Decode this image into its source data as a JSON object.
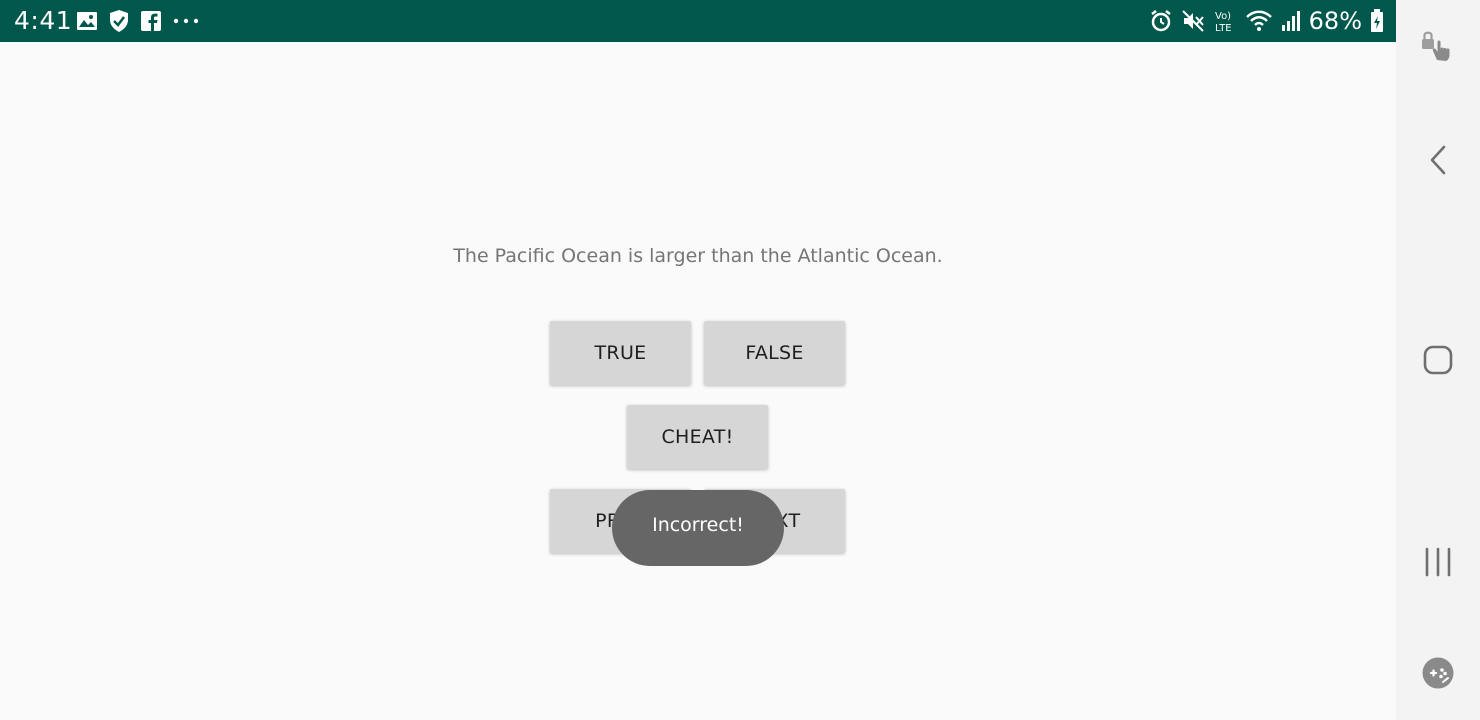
{
  "status_bar": {
    "time": "4:41",
    "left_icons": [
      "gallery-icon",
      "shield-icon",
      "facebook-icon",
      "more-dots-icon"
    ],
    "right_icons": [
      "alarm-icon",
      "mute-icon",
      "volte-icon",
      "wifi-icon",
      "signal-icon"
    ],
    "battery": "68%",
    "background": "#00574b"
  },
  "question": {
    "text": "The Pacific Ocean is larger than the Atlantic Ocean."
  },
  "buttons": {
    "true_label": "TRUE",
    "false_label": "FALSE",
    "cheat_label": "CHEAT!",
    "prev_label": "PREV",
    "next_label": "NEXT"
  },
  "toast": {
    "text": "Incorrect!"
  },
  "nav_bar": {
    "icons": [
      "touch-lock-icon",
      "back-icon",
      "home-icon",
      "recents-icon",
      "game-tools-icon"
    ]
  }
}
